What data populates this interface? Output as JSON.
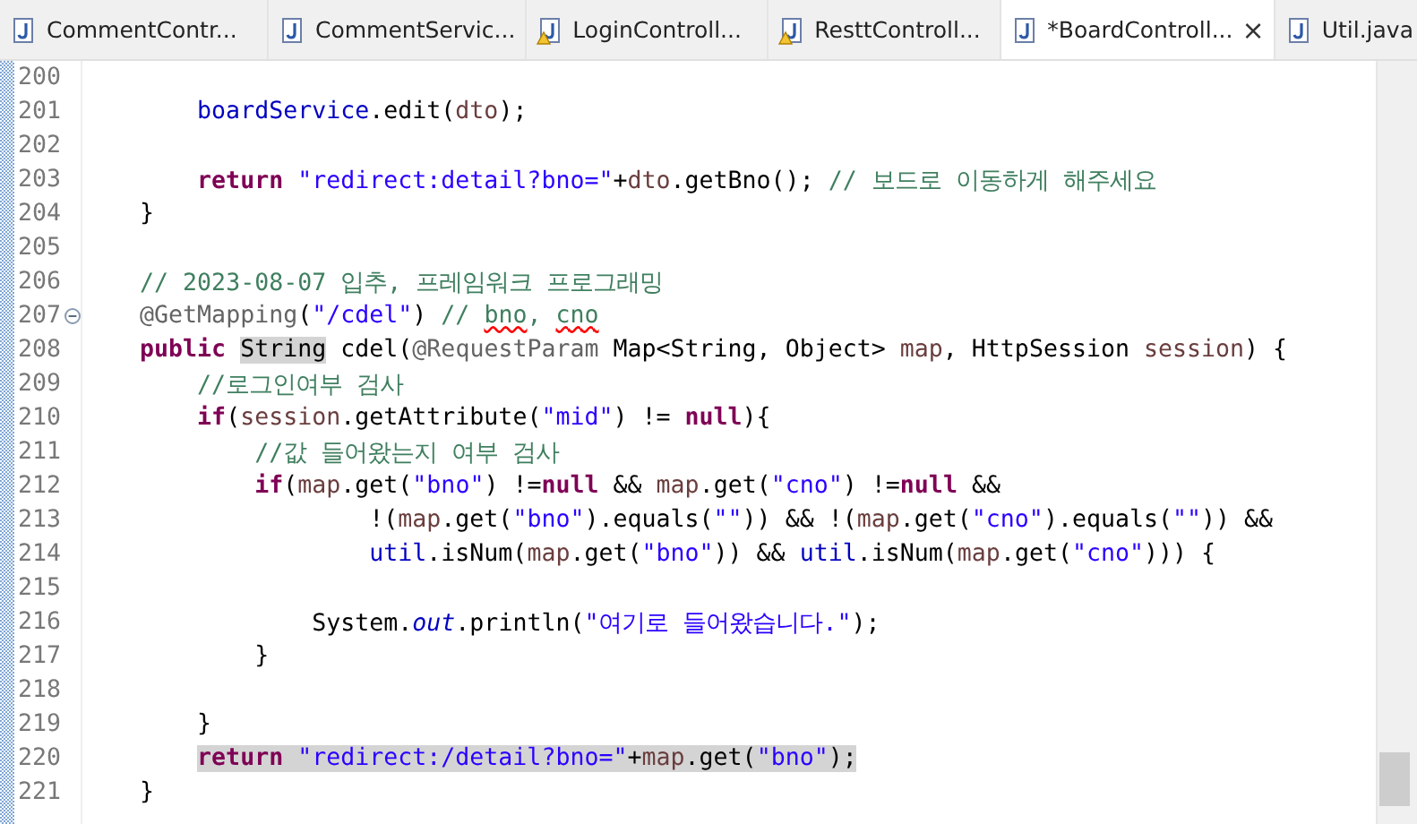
{
  "tabs": [
    {
      "label": "CommentContr...",
      "warning": false,
      "selected": false
    },
    {
      "label": "CommentServic...",
      "warning": false,
      "selected": false
    },
    {
      "label": "LoginControll...",
      "warning": true,
      "selected": false
    },
    {
      "label": "ResttControll...",
      "warning": true,
      "selected": false
    },
    {
      "label": "*BoardControll...",
      "warning": false,
      "selected": true,
      "close": "×"
    },
    {
      "label": "Util.java",
      "warning": false,
      "selected": false
    }
  ],
  "editor": {
    "lines": [
      {
        "number": "200"
      },
      {
        "number": "201",
        "tokens": [
          {
            "kind": "field",
            "text": "        boardService"
          },
          {
            "kind": "plain",
            "text": ".edit("
          },
          {
            "kind": "var",
            "text": "dto"
          },
          {
            "kind": "plain",
            "text": ");"
          }
        ]
      },
      {
        "number": "202"
      },
      {
        "number": "203",
        "tokens": [
          {
            "kind": "kw",
            "text": "        return"
          },
          {
            "kind": "str",
            "text": " \"redirect:detail?bno=\""
          },
          {
            "kind": "plain",
            "text": "+"
          },
          {
            "kind": "var",
            "text": "dto"
          },
          {
            "kind": "plain",
            "text": ".getBno(); "
          },
          {
            "kind": "comment",
            "text": "// 보드로 이동하게 해주세요"
          }
        ]
      },
      {
        "number": "204",
        "tokens": [
          {
            "kind": "plain",
            "text": "    }"
          }
        ]
      },
      {
        "number": "205"
      },
      {
        "number": "206",
        "tokens": [
          {
            "kind": "comment",
            "text": "    // 2023-08-07 입추, 프레임워크 프로그래밍"
          }
        ]
      },
      {
        "number": "207",
        "fold": true,
        "tokens": [
          {
            "kind": "ann",
            "text": "    @GetMapping"
          },
          {
            "kind": "plain",
            "text": "("
          },
          {
            "kind": "str",
            "text": "\"/cdel\""
          },
          {
            "kind": "plain",
            "text": ") "
          },
          {
            "kind": "comment",
            "text": "// "
          },
          {
            "kind": "spell",
            "text": "bno"
          },
          {
            "kind": "comment",
            "text": ", "
          },
          {
            "kind": "spell",
            "text": "cno"
          }
        ]
      },
      {
        "number": "208",
        "tokens": [
          {
            "kind": "kw",
            "text": "    public "
          },
          {
            "kind": "occurrence",
            "text": "String"
          },
          {
            "kind": "plain",
            "text": " cdel("
          },
          {
            "kind": "ann",
            "text": "@RequestParam"
          },
          {
            "kind": "plain",
            "text": " Map<String, Object> "
          },
          {
            "kind": "var",
            "text": "map"
          },
          {
            "kind": "plain",
            "text": ", HttpSession "
          },
          {
            "kind": "var",
            "text": "session"
          },
          {
            "kind": "plain",
            "text": ") {"
          }
        ]
      },
      {
        "number": "209",
        "tokens": [
          {
            "kind": "comment",
            "text": "        //로그인여부 검사"
          }
        ]
      },
      {
        "number": "210",
        "tokens": [
          {
            "kind": "kw",
            "text": "        if"
          },
          {
            "kind": "plain",
            "text": "("
          },
          {
            "kind": "var",
            "text": "session"
          },
          {
            "kind": "plain",
            "text": ".getAttribute("
          },
          {
            "kind": "str",
            "text": "\"mid\""
          },
          {
            "kind": "plain",
            "text": ") != "
          },
          {
            "kind": "kw",
            "text": "null"
          },
          {
            "kind": "plain",
            "text": "){"
          }
        ]
      },
      {
        "number": "211",
        "tokens": [
          {
            "kind": "comment",
            "text": "            //값 들어왔는지 여부 검사"
          }
        ]
      },
      {
        "number": "212",
        "tokens": [
          {
            "kind": "kw",
            "text": "            if"
          },
          {
            "kind": "plain",
            "text": "("
          },
          {
            "kind": "var",
            "text": "map"
          },
          {
            "kind": "plain",
            "text": ".get("
          },
          {
            "kind": "str",
            "text": "\"bno\""
          },
          {
            "kind": "plain",
            "text": ") !="
          },
          {
            "kind": "kw",
            "text": "null"
          },
          {
            "kind": "plain",
            "text": " && "
          },
          {
            "kind": "var",
            "text": "map"
          },
          {
            "kind": "plain",
            "text": ".get("
          },
          {
            "kind": "str",
            "text": "\"cno\""
          },
          {
            "kind": "plain",
            "text": ") !="
          },
          {
            "kind": "kw",
            "text": "null"
          },
          {
            "kind": "plain",
            "text": " &&"
          }
        ]
      },
      {
        "number": "213",
        "tokens": [
          {
            "kind": "plain",
            "text": "                    !("
          },
          {
            "kind": "var",
            "text": "map"
          },
          {
            "kind": "plain",
            "text": ".get("
          },
          {
            "kind": "str",
            "text": "\"bno\""
          },
          {
            "kind": "plain",
            "text": ").equals("
          },
          {
            "kind": "str",
            "text": "\"\""
          },
          {
            "kind": "plain",
            "text": ")) && !("
          },
          {
            "kind": "var",
            "text": "map"
          },
          {
            "kind": "plain",
            "text": ".get("
          },
          {
            "kind": "str",
            "text": "\"cno\""
          },
          {
            "kind": "plain",
            "text": ").equals("
          },
          {
            "kind": "str",
            "text": "\"\""
          },
          {
            "kind": "plain",
            "text": ")) &&"
          }
        ]
      },
      {
        "number": "214",
        "tokens": [
          {
            "kind": "field",
            "text": "                    util"
          },
          {
            "kind": "plain",
            "text": ".isNum("
          },
          {
            "kind": "var",
            "text": "map"
          },
          {
            "kind": "plain",
            "text": ".get("
          },
          {
            "kind": "str",
            "text": "\"bno\""
          },
          {
            "kind": "plain",
            "text": ")) && "
          },
          {
            "kind": "field",
            "text": "util"
          },
          {
            "kind": "plain",
            "text": ".isNum("
          },
          {
            "kind": "var",
            "text": "map"
          },
          {
            "kind": "plain",
            "text": ".get("
          },
          {
            "kind": "str",
            "text": "\"cno\""
          },
          {
            "kind": "plain",
            "text": "))) {"
          }
        ]
      },
      {
        "number": "215"
      },
      {
        "number": "216",
        "tokens": [
          {
            "kind": "plain",
            "text": "                System."
          },
          {
            "kind": "static",
            "text": "out"
          },
          {
            "kind": "plain",
            "text": ".println("
          },
          {
            "kind": "str",
            "text": "\"여기로 들어왔습니다.\""
          },
          {
            "kind": "plain",
            "text": ");"
          }
        ]
      },
      {
        "number": "217",
        "tokens": [
          {
            "kind": "plain",
            "text": "            }"
          }
        ]
      },
      {
        "number": "218"
      },
      {
        "number": "219",
        "tokens": [
          {
            "kind": "plain",
            "text": "        }"
          }
        ]
      },
      {
        "number": "220",
        "highlighted": true,
        "tokens": [
          {
            "kind": "kw",
            "text": "        return"
          },
          {
            "kind": "str",
            "text": " \"redirect:/detail?bno=\""
          },
          {
            "kind": "plain",
            "text": "+"
          },
          {
            "kind": "var",
            "text": "map"
          },
          {
            "kind": "plain",
            "text": ".get("
          },
          {
            "kind": "str",
            "text": "\"bno\""
          },
          {
            "kind": "plain",
            "text": ");"
          }
        ]
      },
      {
        "number": "221",
        "tokens": [
          {
            "kind": "plain",
            "text": "    }"
          }
        ]
      }
    ]
  }
}
